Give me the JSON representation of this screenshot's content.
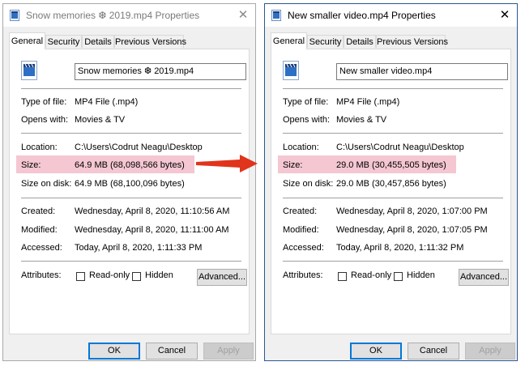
{
  "colors": {
    "highlight": "#f4c7d2",
    "arrow": "#e0341c",
    "active_border": "#2b5797"
  },
  "icons": {
    "title": "video-file-icon",
    "file": "video-file-icon",
    "close": "close-icon"
  },
  "left": {
    "title": "Snow memories ❆ 2019.mp4 Properties",
    "tabs": [
      "General",
      "Security",
      "Details",
      "Previous Versions"
    ],
    "filename": "Snow memories ❆ 2019.mp4",
    "type_label": "Type of file:",
    "type_value": "MP4 File (.mp4)",
    "opens_label": "Opens with:",
    "opens_value": "Movies & TV",
    "location_label": "Location:",
    "location_value": "C:\\Users\\Codrut Neagu\\Desktop",
    "size_label": "Size:",
    "size_value": "64.9 MB (68,098,566 bytes)",
    "disk_label": "Size on disk:",
    "disk_value": "64.9 MB (68,100,096 bytes)",
    "created_label": "Created:",
    "created_value": "Wednesday, April 8, 2020, 11:10:56 AM",
    "modified_label": "Modified:",
    "modified_value": "Wednesday, April 8, 2020, 11:11:00 AM",
    "accessed_label": "Accessed:",
    "accessed_value": "Today, April 8, 2020, 1:11:33 PM",
    "attributes_label": "Attributes:",
    "readonly_label": "Read-only",
    "hidden_label": "Hidden",
    "advanced_label": "Advanced...",
    "ok_label": "OK",
    "cancel_label": "Cancel",
    "apply_label": "Apply"
  },
  "right": {
    "title": "New smaller video.mp4 Properties",
    "tabs": [
      "General",
      "Security",
      "Details",
      "Previous Versions"
    ],
    "filename": "New smaller video.mp4",
    "type_label": "Type of file:",
    "type_value": "MP4 File (.mp4)",
    "opens_label": "Opens with:",
    "opens_value": "Movies & TV",
    "location_label": "Location:",
    "location_value": "C:\\Users\\Codrut Neagu\\Desktop",
    "size_label": "Size:",
    "size_value": "29.0 MB (30,455,505 bytes)",
    "disk_label": "Size on disk:",
    "disk_value": "29.0 MB (30,457,856 bytes)",
    "created_label": "Created:",
    "created_value": "Wednesday, April 8, 2020, 1:07:00 PM",
    "modified_label": "Modified:",
    "modified_value": "Wednesday, April 8, 2020, 1:07:05 PM",
    "accessed_label": "Accessed:",
    "accessed_value": "Today, April 8, 2020, 1:11:32 PM",
    "attributes_label": "Attributes:",
    "readonly_label": "Read-only",
    "hidden_label": "Hidden",
    "advanced_label": "Advanced...",
    "ok_label": "OK",
    "cancel_label": "Cancel",
    "apply_label": "Apply"
  }
}
